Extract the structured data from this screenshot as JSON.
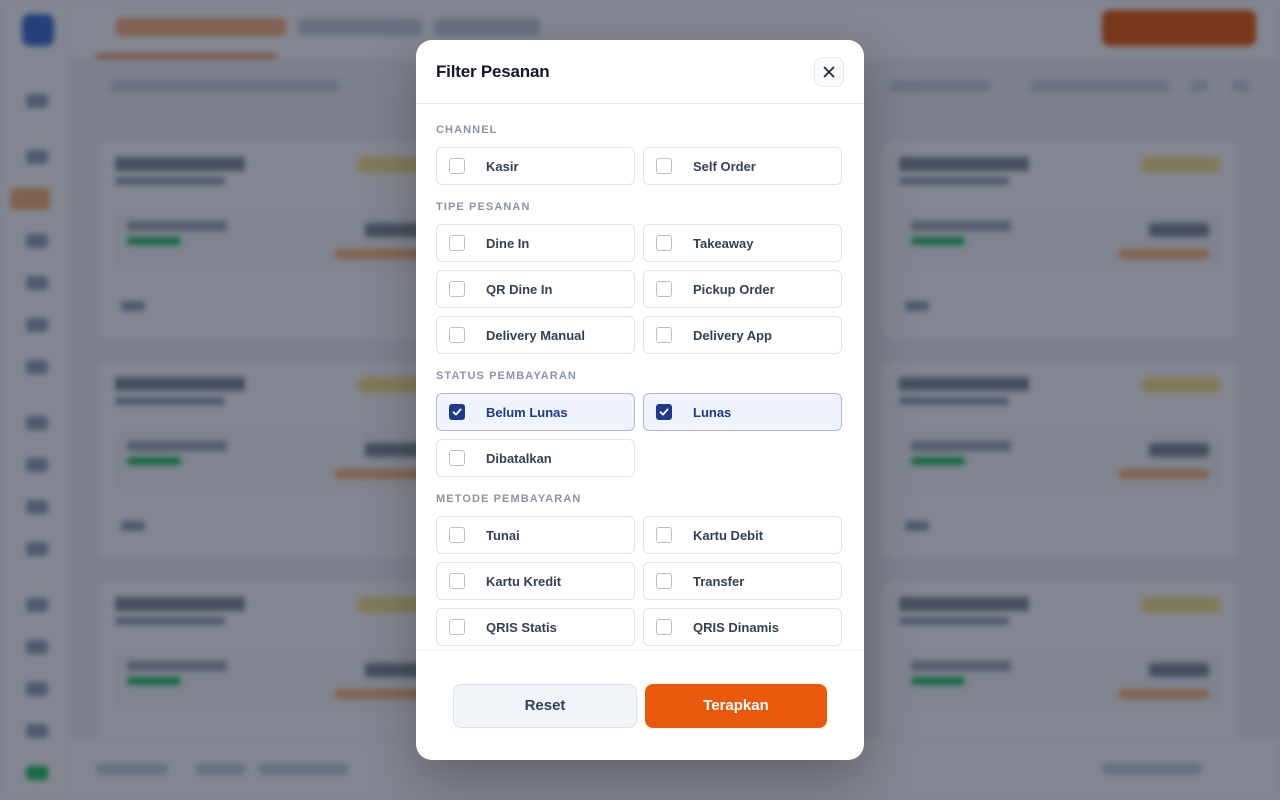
{
  "modal": {
    "title": "Filter Pesanan",
    "sections": {
      "channel": {
        "title": "CHANNEL",
        "options": [
          {
            "label": "Kasir",
            "checked": false
          },
          {
            "label": "Self Order",
            "checked": false
          }
        ]
      },
      "order_type": {
        "title": "TIPE PESANAN",
        "options": [
          {
            "label": "Dine In",
            "checked": false
          },
          {
            "label": "Takeaway",
            "checked": false
          },
          {
            "label": "QR Dine In",
            "checked": false
          },
          {
            "label": "Pickup Order",
            "checked": false
          },
          {
            "label": "Delivery Manual",
            "checked": false
          },
          {
            "label": "Delivery App",
            "checked": false
          }
        ]
      },
      "payment_status": {
        "title": "STATUS PEMBAYARAN",
        "options": [
          {
            "label": "Belum Lunas",
            "checked": true
          },
          {
            "label": "Lunas",
            "checked": true
          },
          {
            "label": "Dibatalkan",
            "checked": false
          }
        ]
      },
      "payment_method": {
        "title": "METODE PEMBAYARAN",
        "options": [
          {
            "label": "Tunai",
            "checked": false
          },
          {
            "label": "Kartu Debit",
            "checked": false
          },
          {
            "label": "Kartu Kredit",
            "checked": false
          },
          {
            "label": "Transfer",
            "checked": false
          },
          {
            "label": "QRIS Statis",
            "checked": false
          },
          {
            "label": "QRIS Dinamis",
            "checked": false
          }
        ]
      }
    },
    "footer": {
      "reset_label": "Reset",
      "apply_label": "Terapkan"
    }
  },
  "colors": {
    "accent": "#ea580c",
    "checked": "#1e3a8a",
    "checked_bg": "#eef3fc",
    "overlay": "rgba(15,23,42,0.52)"
  }
}
